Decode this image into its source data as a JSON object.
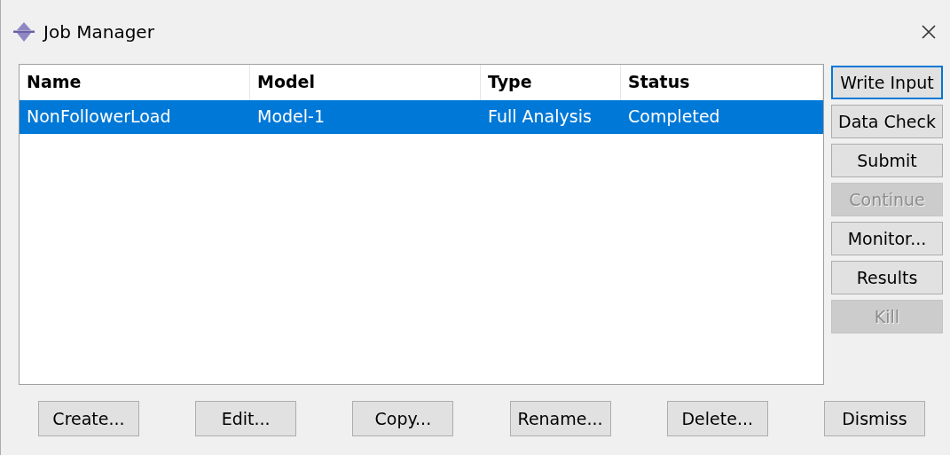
{
  "window": {
    "title": "Job Manager"
  },
  "table": {
    "columns": [
      "Name",
      "Model",
      "Type",
      "Status"
    ],
    "rows": [
      {
        "cells": [
          "NonFollowerLoad",
          "Model-1",
          "Full Analysis",
          "Completed"
        ],
        "selected": true
      }
    ]
  },
  "side_buttons": [
    {
      "label": "Write Input",
      "disabled": false,
      "focused": true
    },
    {
      "label": "Data Check",
      "disabled": false,
      "focused": false
    },
    {
      "label": "Submit",
      "disabled": false,
      "focused": false
    },
    {
      "label": "Continue",
      "disabled": true,
      "focused": false
    },
    {
      "label": "Monitor...",
      "disabled": false,
      "focused": false
    },
    {
      "label": "Results",
      "disabled": false,
      "focused": false
    },
    {
      "label": "Kill",
      "disabled": true,
      "focused": false
    }
  ],
  "bottom_buttons": [
    "Create...",
    "Edit...",
    "Copy...",
    "Rename...",
    "Delete...",
    "Dismiss"
  ]
}
